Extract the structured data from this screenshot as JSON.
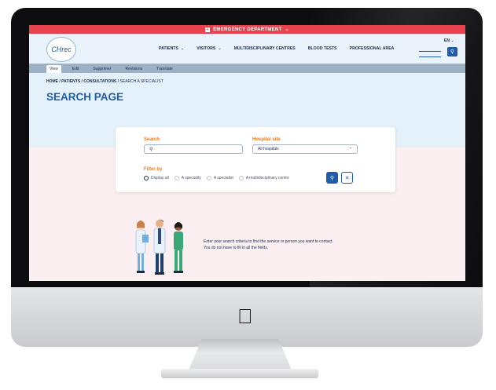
{
  "emergency": {
    "label": "EMERGENCY DEPARTMENT",
    "chevron": "chevron-down-icon"
  },
  "header": {
    "logo_text": "CHrec",
    "nav": [
      "PATIENTS",
      "VISITORS",
      "MULTIDISCIPLINARY CENTRES",
      "BLOOD TESTS",
      "PROFESSIONAL AREA"
    ],
    "language": "EN"
  },
  "admin_tabs": [
    "View",
    "Edit",
    "Supprimer",
    "Revisions",
    "Translate"
  ],
  "breadcrumb": {
    "home": "HOME",
    "patients": "PATIENTS",
    "consultations": "CONSULTATIONS",
    "current": "SEARCH A SPECIALIST"
  },
  "page_title": "SEARCH PAGE",
  "search_form": {
    "search_label": "Search",
    "search_value": "",
    "hospital_label": "Hospital site",
    "hospital_value": "All hospitals",
    "filter_label": "Filter by",
    "filter_options": [
      "Display all",
      "A speciality",
      "A specialist",
      "A multidisciplinary centre"
    ],
    "selected_filter": "Display all"
  },
  "hint": {
    "line1": "Enter your search criteria to find the service or person you want to contact.",
    "line2": "You do not have to fill in all the fields."
  },
  "colors": {
    "accent": "#1f5da8",
    "emergency": "#e8424f",
    "label_orange": "#e97a25"
  }
}
